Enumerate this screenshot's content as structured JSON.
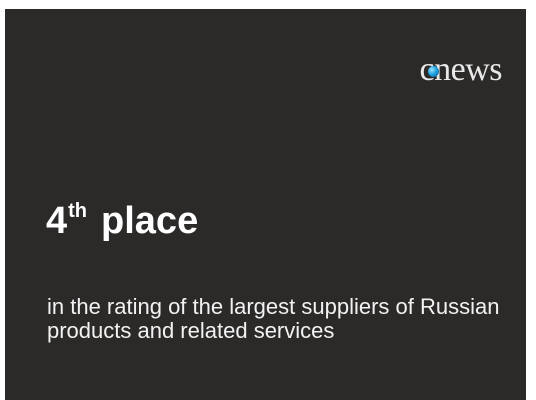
{
  "logo": {
    "text_before": "c",
    "text_after": "news",
    "accent_color": "#1ea3e0"
  },
  "headline": {
    "number": "4",
    "ordinal_suffix": "th",
    "word": "place"
  },
  "description": "in the rating of the largest suppliers of Russian products and related services",
  "colors": {
    "background": "#2c2a29",
    "text": "#ffffff"
  }
}
